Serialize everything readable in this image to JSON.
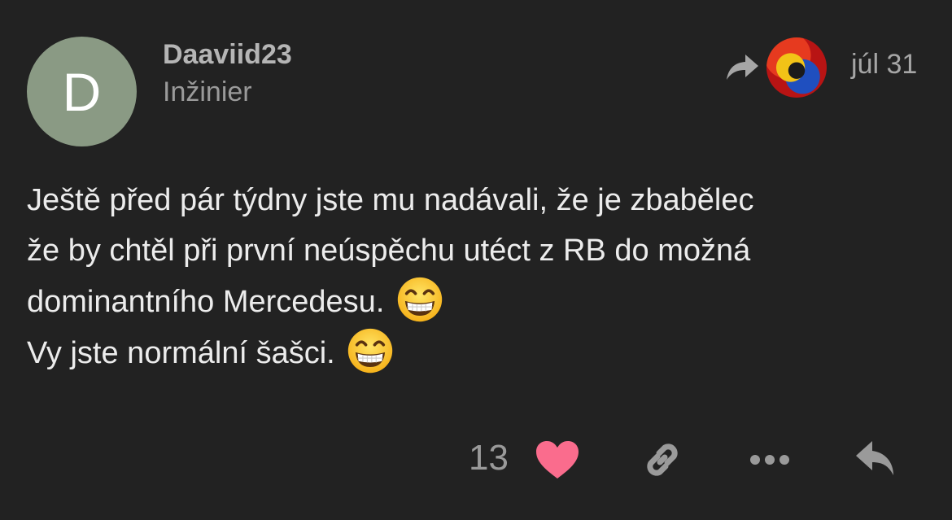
{
  "author": {
    "avatar_letter": "D",
    "avatar_color": "#8a9a84",
    "username": "Daaviid23",
    "title": "Inžinier"
  },
  "meta": {
    "reply_icon": "share-arrow-icon",
    "date": "júl 31"
  },
  "body": {
    "line1": "Ještě před pár týdny jste mu nadávali, že je zbabělec",
    "line2": "že by chtěl při první neúspěchu utéct z RB do možná",
    "line3": "dominantního Mercedesu.",
    "line4": "Vy jste normální šašci.",
    "emoji": "grinning-face-with-smiling-eyes"
  },
  "actions": {
    "like_count": "13",
    "like_color": "#fa6c8d",
    "icon_color": "#9a9a9a",
    "like_icon": "heart-icon",
    "link_icon": "link-icon",
    "more_icon": "more-dots-icon",
    "reply_icon": "reply-icon"
  }
}
